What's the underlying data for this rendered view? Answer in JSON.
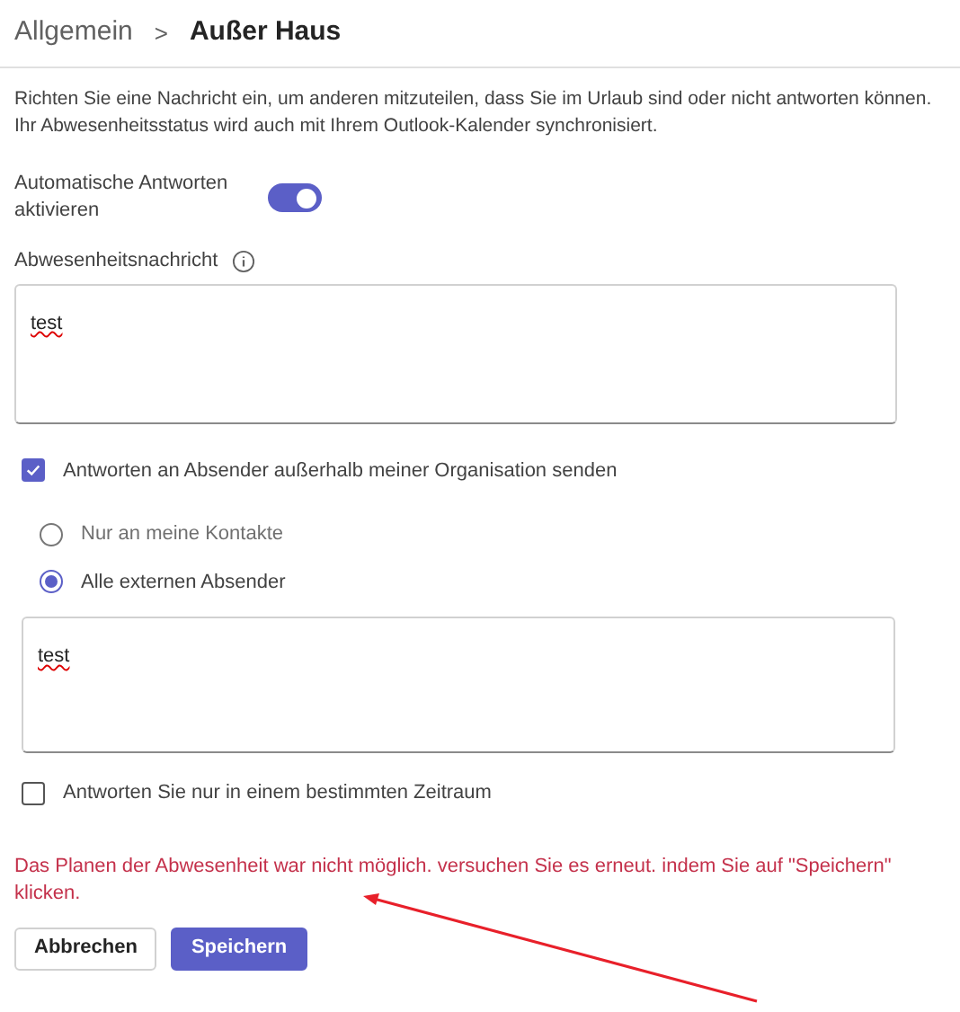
{
  "breadcrumb": {
    "parent": "Allgemein",
    "separator": ">",
    "current": "Außer Haus"
  },
  "description": "Richten Sie eine Nachricht ein, um anderen mitzuteilen, dass Sie im Urlaub sind oder nicht antworten können. Ihr Abwesenheitsstatus wird auch mit Ihrem Outlook-Kalender synchronisiert.",
  "auto_reply": {
    "label": "Automatische Antworten aktivieren",
    "on": true
  },
  "message": {
    "label": "Abwesenheitsnachricht",
    "value": "test"
  },
  "external": {
    "label": "Antworten an Absender außerhalb meiner Organisation senden",
    "checked": true
  },
  "audience": [
    {
      "label": "Nur an meine Kontakte",
      "selected": false
    },
    {
      "label": "Alle externen Absender",
      "selected": true
    }
  ],
  "external_message": {
    "value": "test"
  },
  "time_range": {
    "label": "Antworten Sie nur in einem bestimmten Zeitraum",
    "checked": false
  },
  "error": "Das Planen der Abwesenheit war nicht möglich. versuchen Sie es erneut. indem Sie auf \"Speichern\" klicken.",
  "buttons": [
    {
      "label": "Abbrechen",
      "kind": "secondary"
    },
    {
      "label": "Speichern",
      "kind": "primary"
    }
  ]
}
